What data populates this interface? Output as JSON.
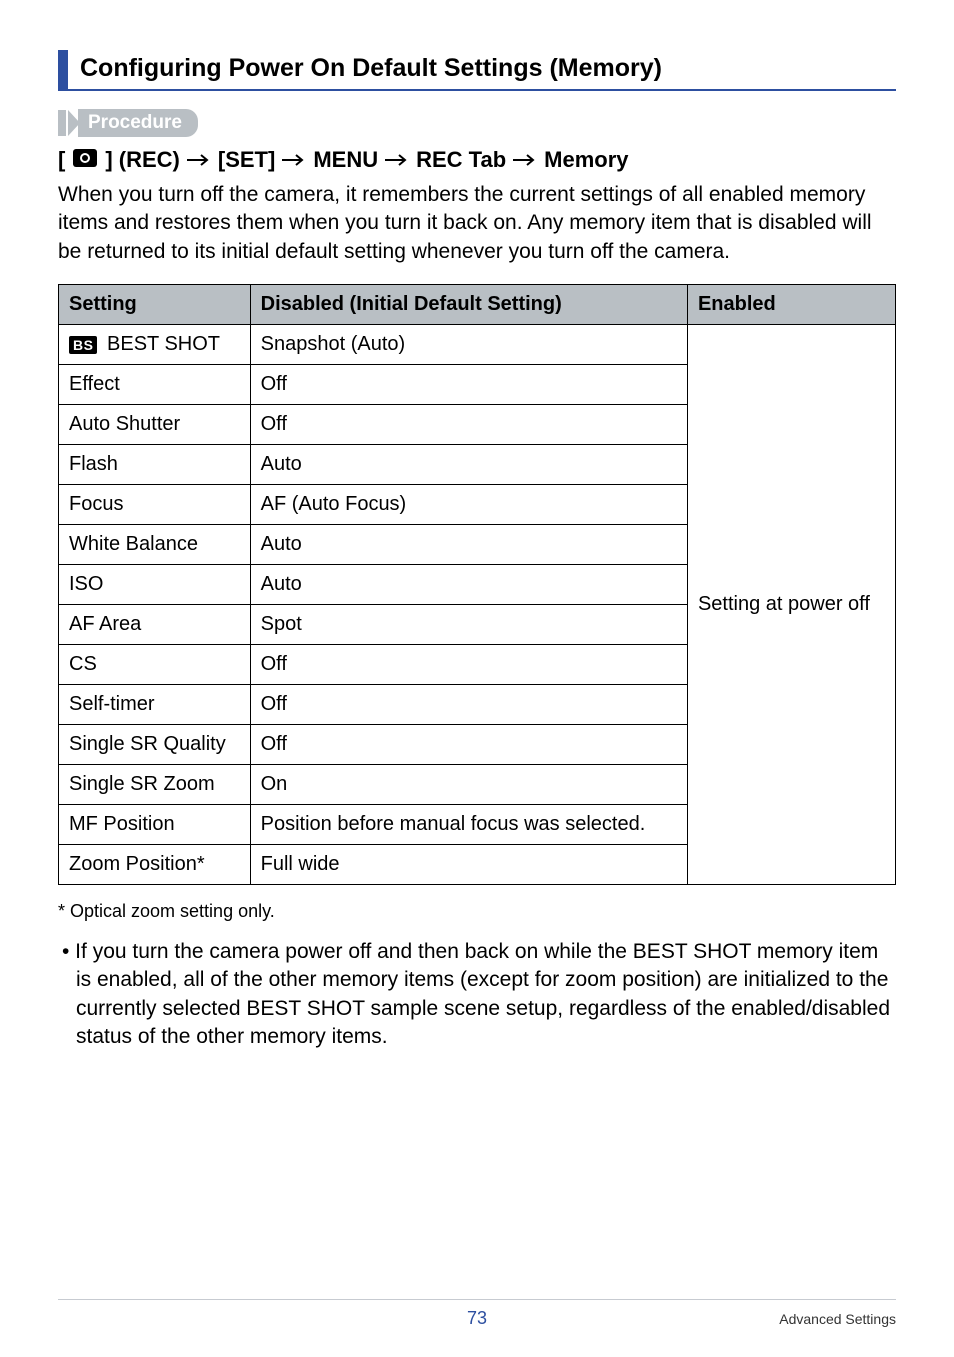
{
  "heading": "Configuring Power On Default Settings (Memory)",
  "procedure_label": "Procedure",
  "breadcrumb": {
    "prefix": "[",
    "icon": "camera-icon",
    "part1": "] (REC)",
    "part2": "[SET]",
    "part3": "MENU",
    "part4": "REC Tab",
    "part5": "Memory"
  },
  "intro": "When you turn off the camera, it remembers the current settings of all enabled memory items and restores them when you turn it back on. Any memory item that is disabled will be returned to its initial default setting whenever you turn off the camera.",
  "table": {
    "headers": {
      "setting": "Setting",
      "disabled": "Disabled (Initial Default Setting)",
      "enabled": "Enabled"
    },
    "rows": [
      {
        "setting_icon": "BS",
        "setting": "BEST SHOT",
        "disabled": "Snapshot (Auto)"
      },
      {
        "setting": "Effect",
        "disabled": "Off"
      },
      {
        "setting": "Auto Shutter",
        "disabled": "Off"
      },
      {
        "setting": "Flash",
        "disabled": "Auto"
      },
      {
        "setting": "Focus",
        "disabled": "AF (Auto Focus)"
      },
      {
        "setting": "White Balance",
        "disabled": "Auto"
      },
      {
        "setting": "ISO",
        "disabled": "Auto"
      },
      {
        "setting": "AF Area",
        "disabled": "Spot"
      },
      {
        "setting": "CS",
        "disabled": "Off"
      },
      {
        "setting": "Self-timer",
        "disabled": "Off"
      },
      {
        "setting": "Single SR Quality",
        "disabled": "Off"
      },
      {
        "setting": "Single SR Zoom",
        "disabled": "On"
      },
      {
        "setting": "MF Position",
        "disabled": "Position before manual focus was selected."
      },
      {
        "setting": "Zoom Position*",
        "disabled": "Full wide"
      }
    ],
    "enabled_text": "Setting at power off"
  },
  "footnote": "* Optical zoom setting only.",
  "bullet": "• If you turn the camera power off and then back on while the BEST SHOT memory item is enabled, all of the other memory items (except for zoom position) are initialized to the currently selected BEST SHOT sample scene setup, regardless of the enabled/disabled status of the other memory items.",
  "footer": {
    "page": "73",
    "section": "Advanced Settings"
  }
}
